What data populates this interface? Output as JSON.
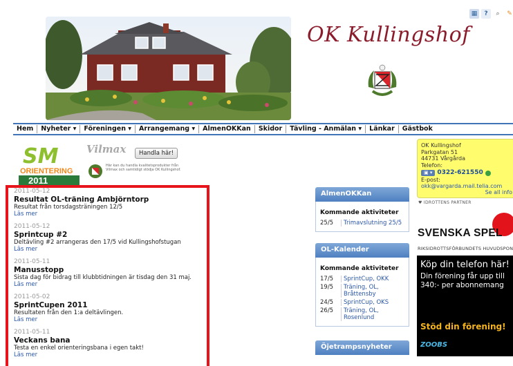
{
  "header": {
    "site_title": "OK Kullingshof"
  },
  "nav": {
    "items": [
      {
        "label": "Hem"
      },
      {
        "label": "Nyheter ▾"
      },
      {
        "label": "Föreningen ▾"
      },
      {
        "label": "Arrangemang ▾"
      },
      {
        "label": "AlmenOKKan"
      },
      {
        "label": "Skidor"
      },
      {
        "label": "Tävling - Anmälan ▾"
      },
      {
        "label": "Länkar"
      },
      {
        "label": "Gästbok"
      }
    ]
  },
  "banners": {
    "sm_text": "SM",
    "orientering": "ORIENTERING",
    "year": "2011",
    "vilmax_brand": "Vilmax",
    "vilmax_button": "Handla här!",
    "vilmax_small": "Här kan du handla kvalitetsprodukter från Vilmax och samtidigt stödja OK Kullingshof."
  },
  "contact": {
    "name": "OK Kullingshof",
    "street": "Parkgatan 51",
    "city": "44731 Vårgårda",
    "phone_label": "Telefon:",
    "phone_pill": "▣ ▾",
    "phone": "0322-621550",
    "email_label": "E-post:",
    "email": "okk@vargarda.mail.telia.com",
    "see_all": "Se all info"
  },
  "sponsors": {
    "partner_label": "♥ IDROTTENS PARTNER",
    "svenska_spel": "SVENSKA SPEL",
    "riks": "RIKSIDROTTSFÖRBUNDETS HUVUDSPONSOR",
    "ad_line1": "Köp din telefon här!",
    "ad_line2": "Din förening får upp till 340:- per abonnemang",
    "ad_cta": "Stöd din förening!",
    "ad_brand": "ZOOBS"
  },
  "news": [
    {
      "date": "2011-05-12",
      "title": "Resultat OL-träning Ambjörntorp",
      "desc": "Resultat från torsdagsträningen 12/5",
      "more": "Läs mer"
    },
    {
      "date": "2011-05-12",
      "title": "Sprintcup #2",
      "desc": "Deltävling #2 arrangeras den 17/5 vid Kullingshofstugan",
      "more": "Läs mer"
    },
    {
      "date": "2011-05-11",
      "title": "Manusstopp",
      "desc": "Sista dag för bidrag till klubbtidningen är tisdag den 31 maj.",
      "more": "Läs mer"
    },
    {
      "date": "2011-05-02",
      "title": "SprintCupen 2011",
      "desc": "Resultaten från den 1:a deltävlingen.",
      "more": "Läs mer"
    },
    {
      "date": "2011-05-11",
      "title": "Veckans bana",
      "desc": "Testa en enkel orienteringsbana i egen takt!",
      "more": "Läs mer"
    }
  ],
  "widgets": {
    "almen": {
      "title": "AlmenOKKan",
      "sub": "Kommande aktiviteter",
      "rows": [
        {
          "date": "25/5",
          "name": "Trimavslutning 25/5"
        }
      ]
    },
    "ol": {
      "title": "OL-Kalender",
      "sub": "Kommande aktiviteter",
      "rows": [
        {
          "date": "17/5",
          "name": "SprintCup, OKK"
        },
        {
          "date": "19/5",
          "name": "Träning, OL, Bråttensby"
        },
        {
          "date": "24/5",
          "name": "SprintCup, OKS"
        },
        {
          "date": "26/5",
          "name": "Träning, OL, Rosenlund"
        }
      ]
    },
    "oje": {
      "title": "Öjetrampsnyheter"
    }
  },
  "colors": {
    "accent": "#3f74b8",
    "title": "#8b1c2c",
    "highlight_border": "#e8141c",
    "contact_bg": "#fffc6e"
  }
}
